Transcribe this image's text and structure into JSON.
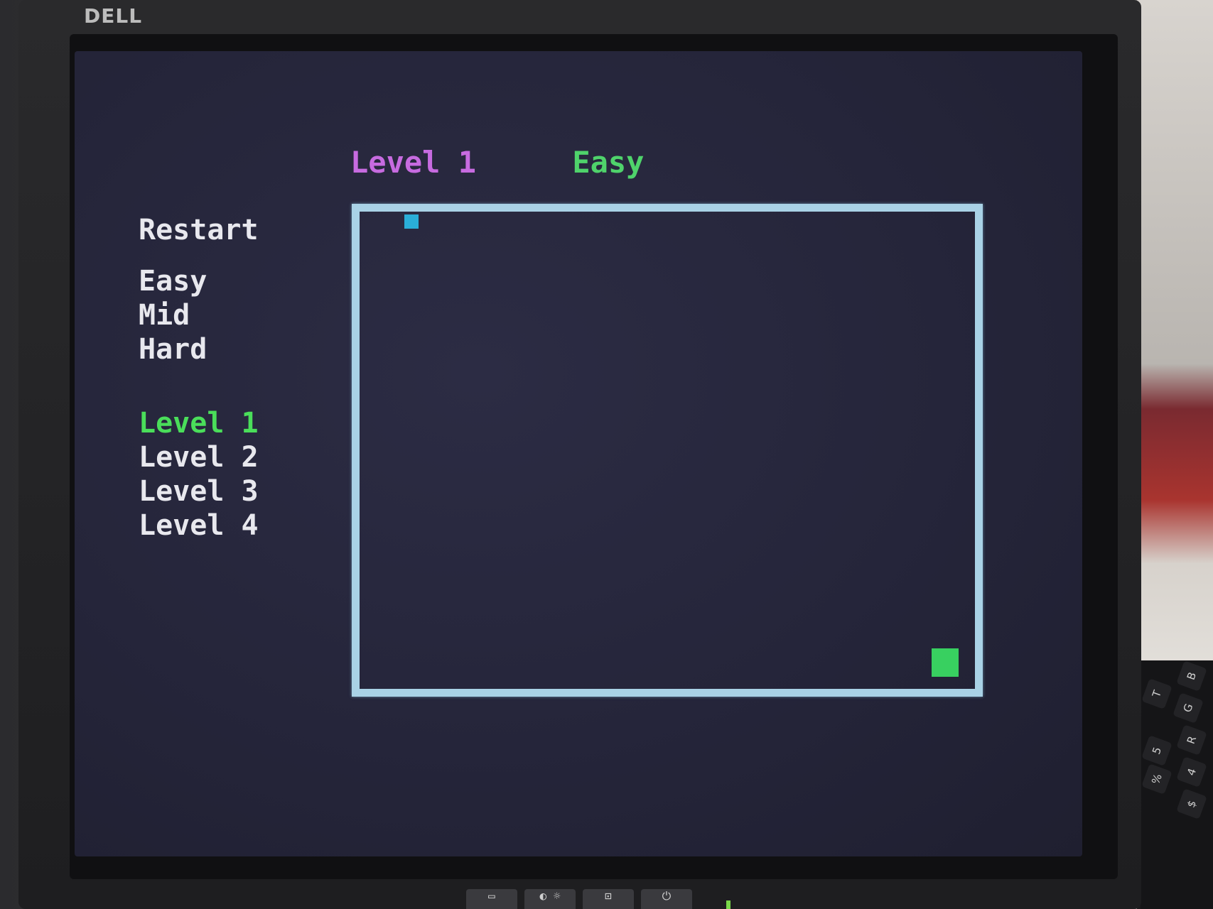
{
  "monitor": {
    "brand": "DELL"
  },
  "hud": {
    "level_label": "Level 1",
    "difficulty_label": "Easy"
  },
  "menu": {
    "restart": "Restart",
    "difficulties": [
      "Easy",
      "Mid",
      "Hard"
    ],
    "levels": [
      "Level 1",
      "Level 2",
      "Level 3",
      "Level 4"
    ],
    "active_level": "Level 1"
  },
  "game": {
    "player_color": "#2aaed8",
    "goal_color": "#38d060",
    "border_color": "#a9d2e6"
  },
  "monitor_buttons": {
    "icons": [
      "menu-icon",
      "contrast-icon",
      "brightness-icon",
      "input-source-icon",
      "power-icon"
    ]
  },
  "keyboard": {
    "keys": [
      "B",
      "G",
      "T",
      "5",
      "%",
      "R",
      "4",
      "$"
    ]
  },
  "colors": {
    "menu_text": "#e8e8ee",
    "active_level": "#4ade5a",
    "hud_level": "#c76be0",
    "hud_difficulty": "#4fd36b",
    "screen_bg": "#25253a"
  }
}
